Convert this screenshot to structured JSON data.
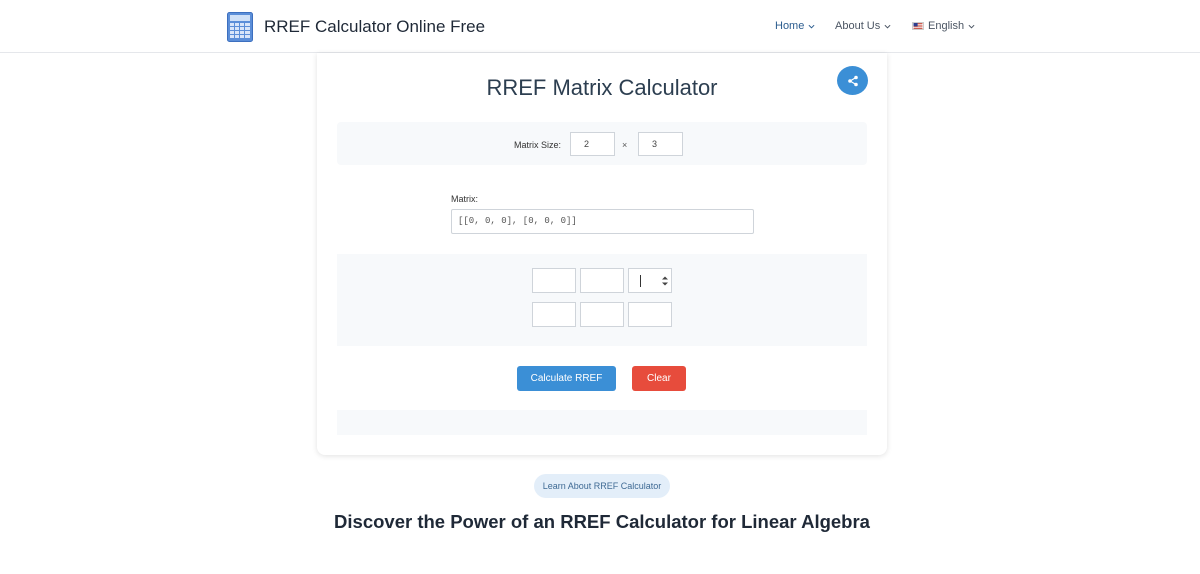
{
  "header": {
    "brand": "RREF Calculator Online Free",
    "nav": {
      "home": "Home",
      "about": "About Us",
      "language": "English"
    }
  },
  "calculator": {
    "title": "RREF Matrix Calculator",
    "size_label": "Matrix Size:",
    "rows_value": "2",
    "times_symbol": "×",
    "cols_value": "3",
    "matrix_label": "Matrix:",
    "matrix_text": "[[0, 0, 0], [0, 0, 0]]",
    "calculate_label": "Calculate RREF",
    "clear_label": "Clear"
  },
  "learn_label": "Learn About RREF Calculator",
  "discover_heading": "Discover the Power of an RREF Calculator for Linear Algebra",
  "icons": {
    "logo": "calculator-icon",
    "share": "share-icon",
    "flag": "us-flag-icon"
  },
  "colors": {
    "primary": "#3b8fd6",
    "danger": "#e74c3c",
    "panel": "#f7f9fb"
  }
}
